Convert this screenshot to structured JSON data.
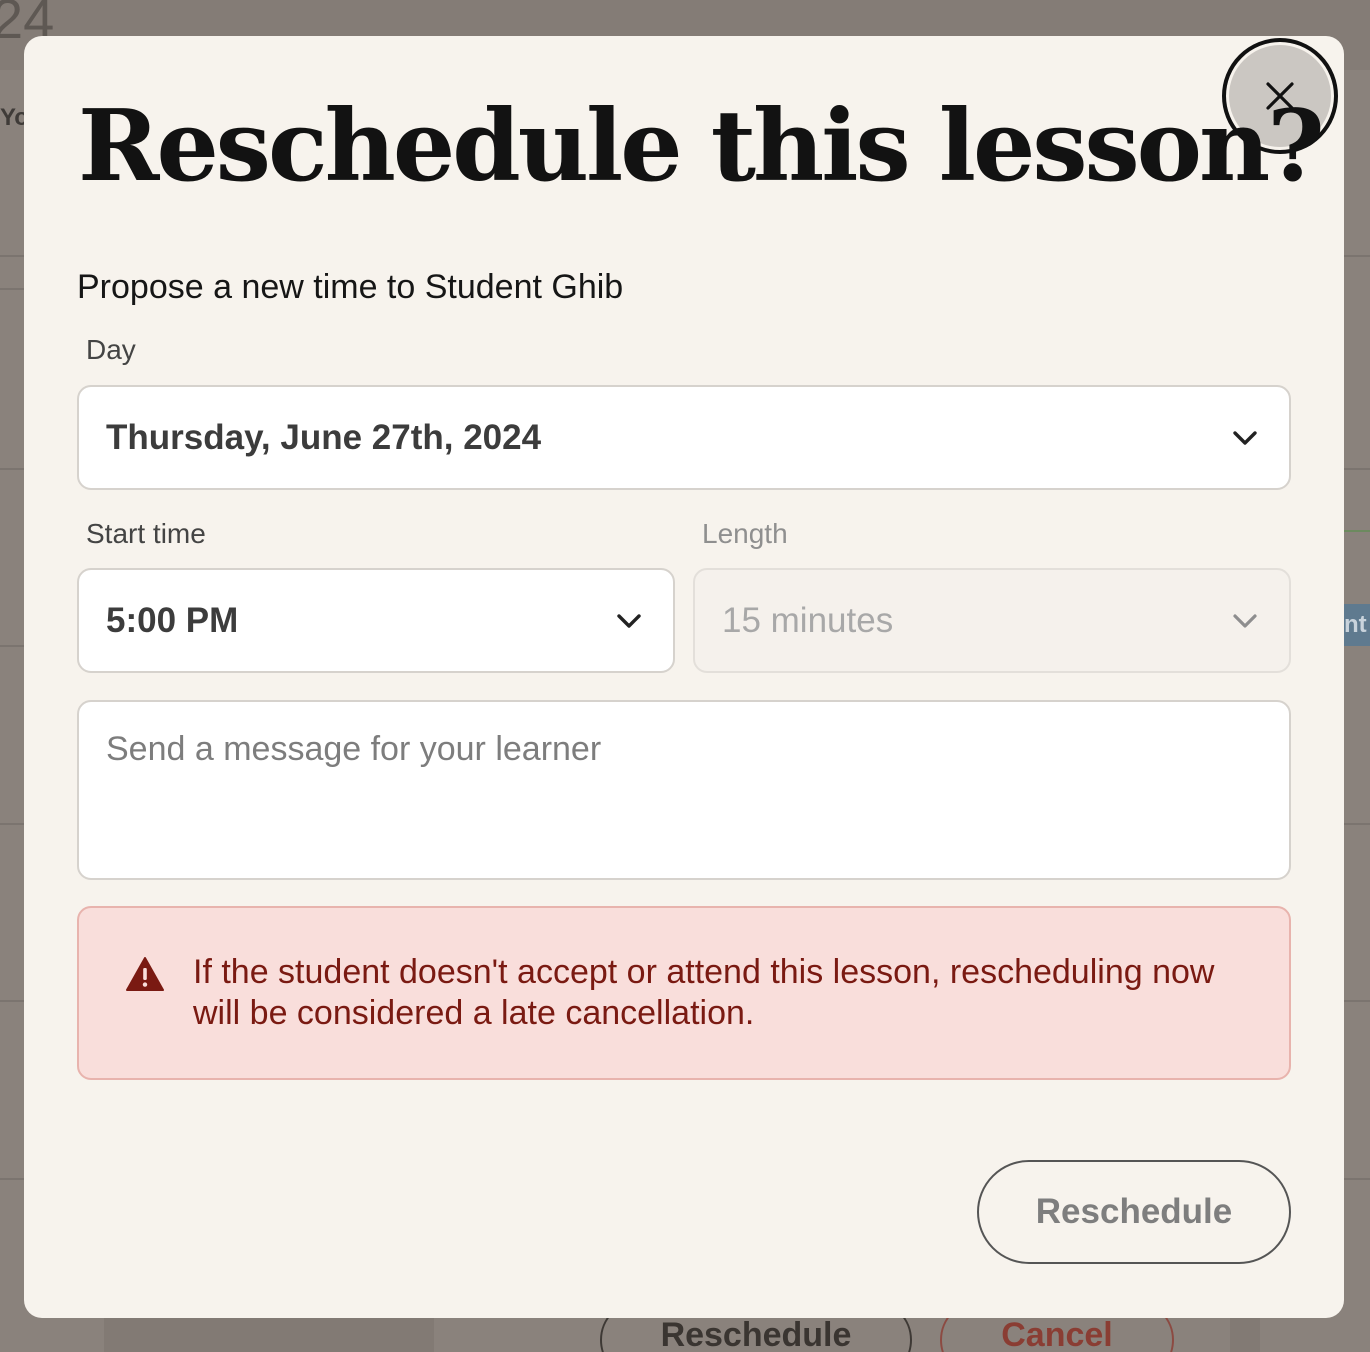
{
  "background": {
    "year_fragment": "24",
    "side_text": "Yo",
    "right_tag": "nt",
    "buttons": {
      "reschedule": "Reschedule",
      "cancel": "Cancel"
    }
  },
  "modal": {
    "title": "Reschedule this lesson?",
    "close_icon": "close-icon",
    "subtitle": "Propose a new time to Student Ghib",
    "day": {
      "label": "Day",
      "value": "Thursday, June 27th, 2024"
    },
    "start_time": {
      "label": "Start time",
      "value": "5:00 PM"
    },
    "length": {
      "label": "Length",
      "value": "15 minutes",
      "disabled": true
    },
    "message": {
      "placeholder": "Send a message for your learner",
      "value": ""
    },
    "warning": {
      "icon": "warning-icon",
      "text": "If the student doesn't accept or attend this lesson, rescheduling now will be considered a late cancellation."
    },
    "submit_label": "Reschedule"
  },
  "colors": {
    "overlay": "#8a827c",
    "modal_bg": "#f7f3ed",
    "alert_bg": "#f9dedb",
    "alert_border": "#e8b3ad",
    "alert_text": "#7a1a12",
    "title_text": "#121212"
  }
}
